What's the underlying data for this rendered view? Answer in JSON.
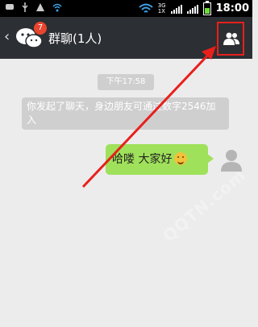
{
  "status_bar": {
    "time": "18:00",
    "network_top": "3G",
    "network_bottom": "1X"
  },
  "header": {
    "back_glyph": "‹",
    "badge_count": "7",
    "title": "群聊(1人)",
    "members_icon": "group-members-icon"
  },
  "chat": {
    "timestamp": "下午17:58",
    "system_message": "你发起了聊天，身边朋友可通过数字2546加入",
    "my_message": "哈喽  大家好",
    "emoji": "smile-emoji"
  },
  "watermark": "QQTN.com",
  "colors": {
    "header_bg": "#2c2f33",
    "chat_bg": "#ececec",
    "bubble_green": "#9fe15a",
    "highlight_red": "#e8201c",
    "badge_red": "#e8452f"
  }
}
